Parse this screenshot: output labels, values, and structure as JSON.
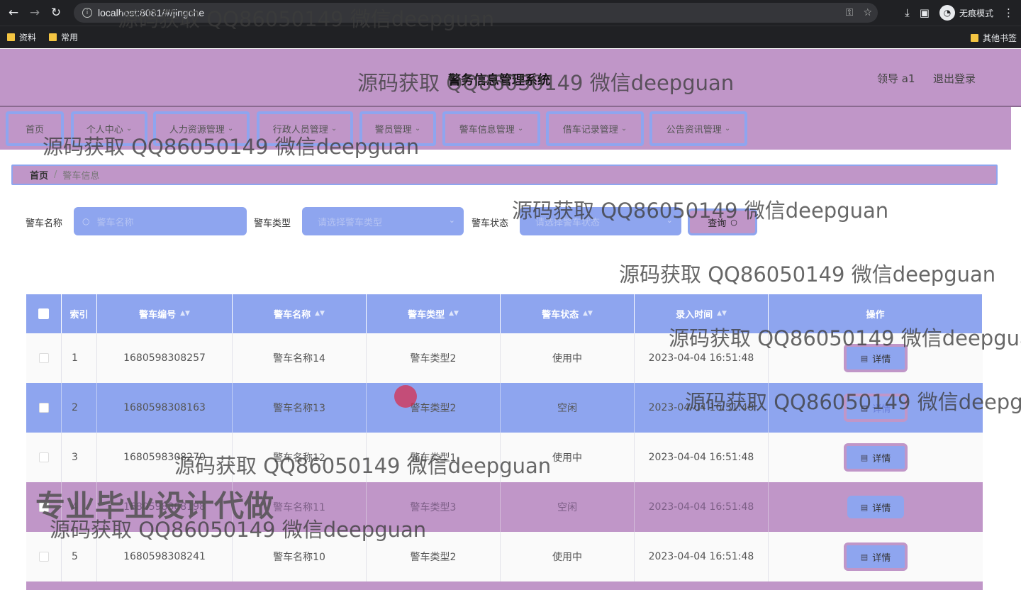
{
  "browser": {
    "url": "localhost:8081/#/jingche",
    "incognito_label": "无痕模式",
    "bookmarks": [
      "资料",
      "常用"
    ],
    "other_bookmarks": "其他书签"
  },
  "header": {
    "title": "警务信息管理系统",
    "user": "领导 a1",
    "logout": "退出登录"
  },
  "nav": {
    "items": [
      "首页",
      "个人中心",
      "人力资源管理",
      "行政人员管理",
      "警员管理",
      "警车信息管理",
      "借车记录管理",
      "公告资讯管理"
    ]
  },
  "breadcrumb": {
    "home": "首页",
    "current": "警车信息"
  },
  "search": {
    "name_label": "警车名称",
    "name_placeholder": "警车名称",
    "type_label": "警车类型",
    "type_placeholder": "请选择警车类型",
    "status_label": "警车状态",
    "status_placeholder": "请选择警车状态",
    "query_button": "查询"
  },
  "table": {
    "headers": [
      "索引",
      "警车编号",
      "警车名称",
      "警车类型",
      "警车状态",
      "录入时间",
      "操作"
    ],
    "rows": [
      {
        "index": "1",
        "code": "1680598308257",
        "name": "警车名称14",
        "type": "警车类型2",
        "status": "使用中",
        "time": "2023-04-04 16:51:48",
        "action": "详情"
      },
      {
        "index": "2",
        "code": "1680598308163",
        "name": "警车名称13",
        "type": "警车类型2",
        "status": "空闲",
        "time": "2023-04-04 16:51:48",
        "action": "详情"
      },
      {
        "index": "3",
        "code": "1680598308270",
        "name": "警车名称12",
        "type": "警车类型1",
        "status": "使用中",
        "time": "2023-04-04 16:51:48",
        "action": "详情"
      },
      {
        "index": "4",
        "code": "1680598308198",
        "name": "警车名称11",
        "type": "警车类型3",
        "status": "空闲",
        "time": "2023-04-04 16:51:48",
        "action": "详情"
      },
      {
        "index": "5",
        "code": "1680598308241",
        "name": "警车名称10",
        "type": "警车类型2",
        "status": "使用中",
        "time": "2023-04-04 16:51:48",
        "action": "详情"
      }
    ]
  },
  "overlay": {
    "watermark": "源码获取 QQ86050149 微信deepguan",
    "promo": "专业毕业设计代做"
  }
}
